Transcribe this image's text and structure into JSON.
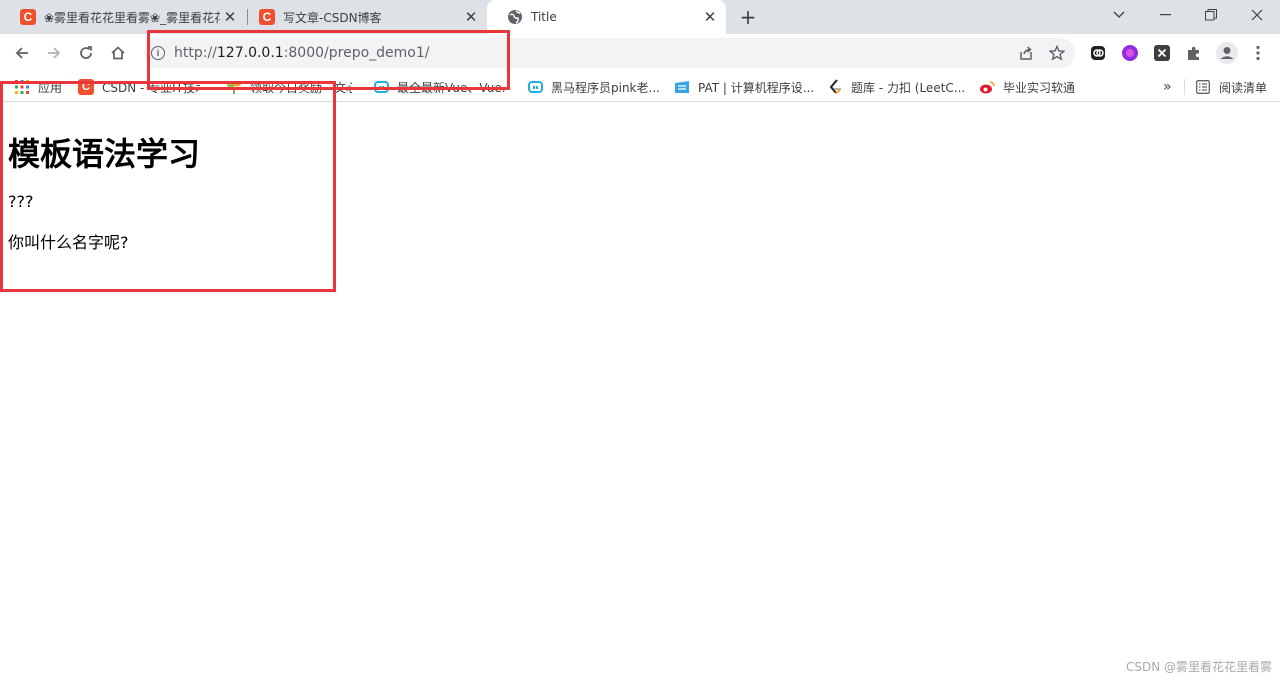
{
  "tabs": [
    {
      "title": "❀雾里看花花里看雾❀_雾里看花花",
      "icon": "csdn-logo-icon",
      "active": false
    },
    {
      "title": "写文章-CSDN博客",
      "icon": "csdn-logo-icon",
      "active": false
    },
    {
      "title": "Title",
      "icon": "globe-icon",
      "active": true
    }
  ],
  "tab_icon_letter": "C",
  "address_bar": {
    "url_scheme": "http://",
    "url_host": "127.0.0.1",
    "url_rest": ":8000/prepo_demo1/"
  },
  "bookmarks": [
    {
      "label": "应用",
      "icon": "apps-grid-icon"
    },
    {
      "label": "CSDN - 专业IT技术",
      "icon": "csdn-logo-icon"
    },
    {
      "label": "领取今日奖励 - 文心",
      "icon": "plant-icon"
    },
    {
      "label": "最全最新Vue、Vue...",
      "icon": "bilibili-icon"
    },
    {
      "label": "黑马程序员pink老...",
      "icon": "bilibili-icon"
    },
    {
      "label": "PAT | 计算机程序设...",
      "icon": "pat-icon"
    },
    {
      "label": "题库 - 力扣 (LeetC...",
      "icon": "leetcode-icon"
    },
    {
      "label": "毕业实习软通",
      "icon": "weibo-icon"
    }
  ],
  "bookmarks_overflow": "»",
  "reading_list": {
    "label": "阅读清单",
    "icon": "reading-list-icon"
  },
  "page": {
    "heading": "模板语法学习",
    "line1": "???",
    "line2": "你叫什么名字呢?"
  },
  "watermark": "CSDN @雾里看花花里看雾",
  "colors": {
    "highlight": "#e8363b",
    "csdn": "#f1502f",
    "tabstrip": "#dee1e6"
  }
}
